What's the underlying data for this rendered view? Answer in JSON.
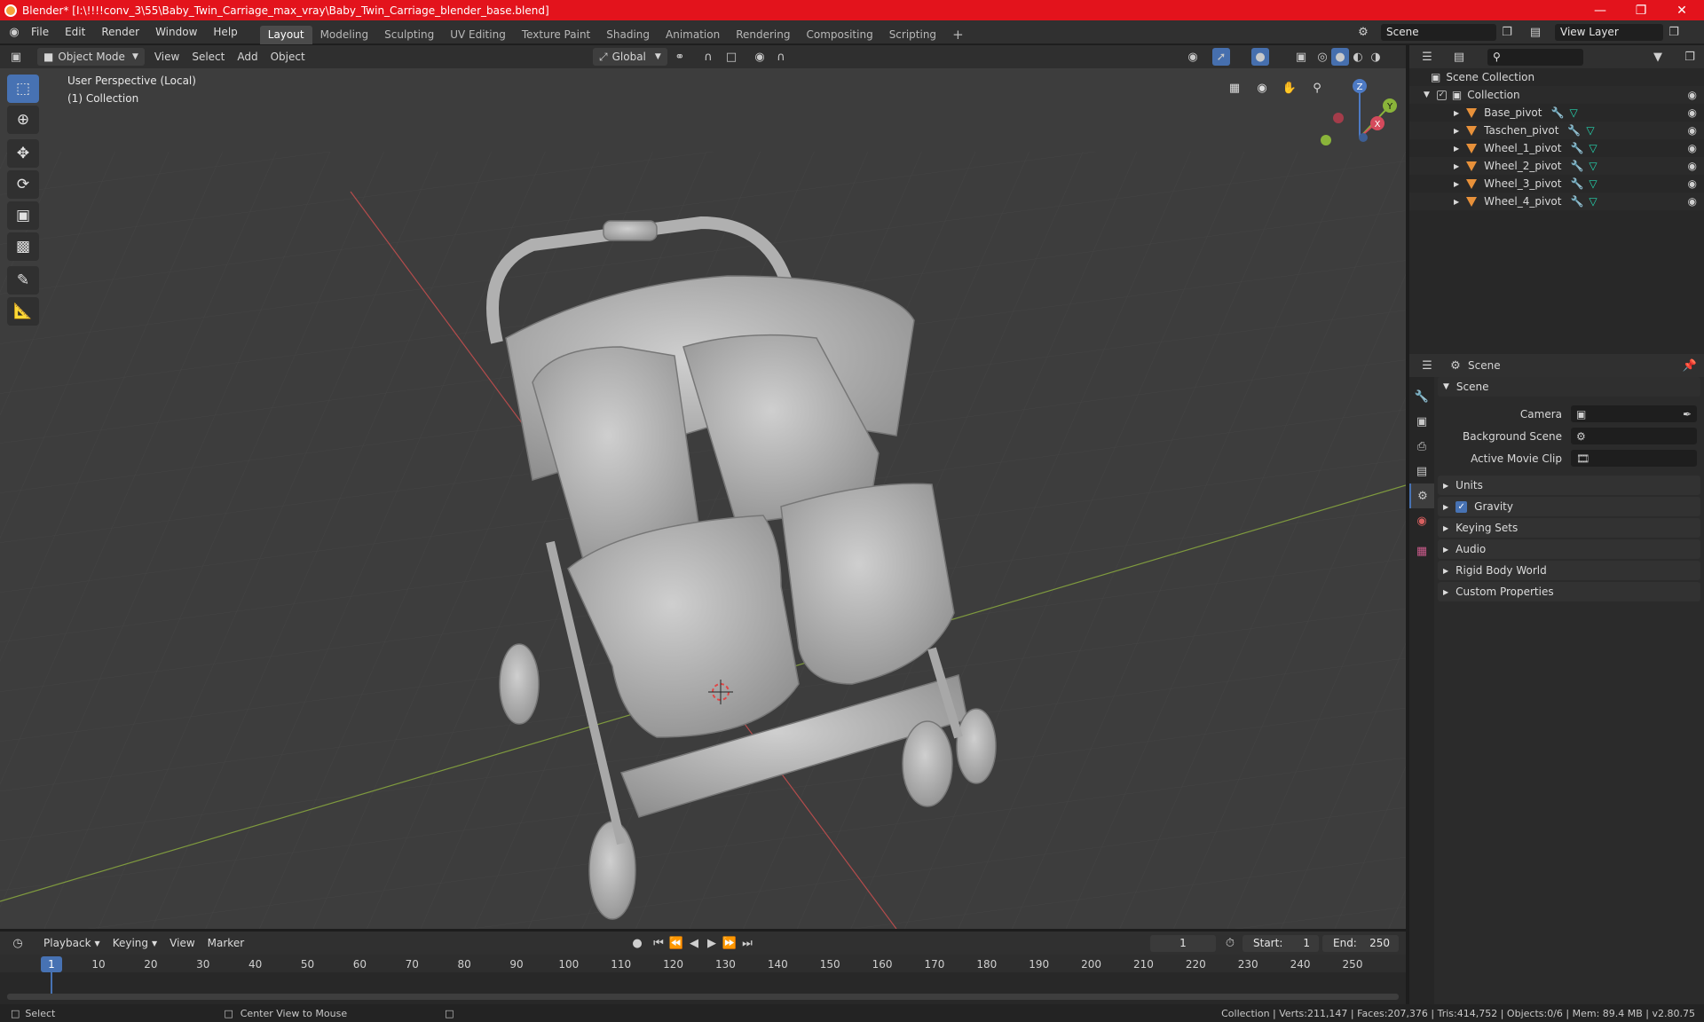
{
  "window": {
    "title": "Blender* [I:\\!!!!conv_3\\55\\Baby_Twin_Carriage_max_vray\\Baby_Twin_Carriage_blender_base.blend]"
  },
  "menus": [
    "File",
    "Edit",
    "Render",
    "Window",
    "Help"
  ],
  "workspaces": [
    "Layout",
    "Modeling",
    "Sculpting",
    "UV Editing",
    "Texture Paint",
    "Shading",
    "Animation",
    "Rendering",
    "Compositing",
    "Scripting"
  ],
  "active_workspace": "Layout",
  "scene_field": "Scene",
  "view_layer_field": "View Layer",
  "viewport": {
    "mode": "Object Mode",
    "menus": [
      "View",
      "Select",
      "Add",
      "Object"
    ],
    "transform_orientation": "Global",
    "overlay_line1": "User Perspective (Local)",
    "overlay_line2": "(1) Collection",
    "gizmo": {
      "x": "X",
      "y": "Y",
      "z": "Z"
    }
  },
  "outliner": {
    "root": "Scene Collection",
    "collection": "Collection",
    "objects": [
      "Base_pivot",
      "Taschen_pivot",
      "Wheel_1_pivot",
      "Wheel_2_pivot",
      "Wheel_3_pivot",
      "Wheel_4_pivot"
    ]
  },
  "properties": {
    "context": "Scene",
    "section": "Scene",
    "camera_label": "Camera",
    "bg_scene_label": "Background Scene",
    "movie_clip_label": "Active Movie Clip",
    "panels": [
      "Units",
      "Gravity",
      "Keying Sets",
      "Audio",
      "Rigid Body World",
      "Custom Properties"
    ]
  },
  "timeline": {
    "menus": [
      "Playback",
      "Keying",
      "View",
      "Marker"
    ],
    "current_frame": "1",
    "start_label": "Start:",
    "start": "1",
    "end_label": "End:",
    "end": "250",
    "ticks": [
      "1",
      "10",
      "20",
      "30",
      "40",
      "50",
      "60",
      "70",
      "80",
      "90",
      "100",
      "110",
      "120",
      "130",
      "140",
      "150",
      "160",
      "170",
      "180",
      "190",
      "200",
      "210",
      "220",
      "230",
      "240",
      "250"
    ]
  },
  "statusbar": {
    "left1": "Select",
    "left2": "Center View to Mouse",
    "right": "Collection | Verts:211,147 | Faces:207,376 | Tris:414,752 | Objects:0/6 | Mem: 89.4 MB | v2.80.75"
  }
}
